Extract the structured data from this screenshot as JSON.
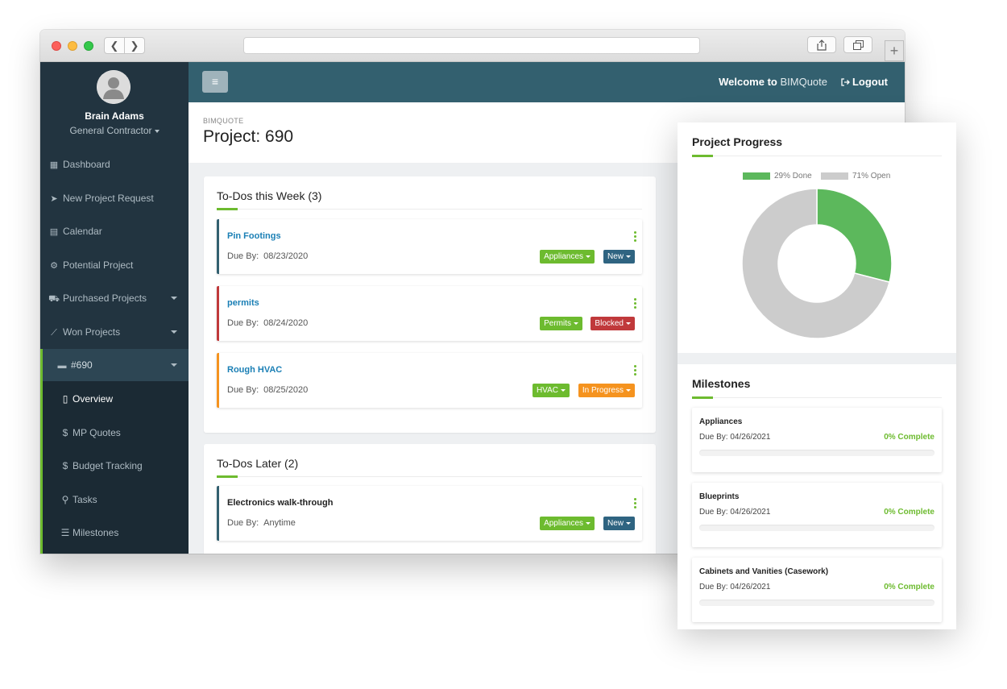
{
  "user": {
    "name": "Brain Adams",
    "role": "General Contractor"
  },
  "sidebar": {
    "items": [
      {
        "label": "Dashboard",
        "icon": "dashboard-icon",
        "has_children": false
      },
      {
        "label": "New Project Request",
        "icon": "paper-plane-icon",
        "has_children": false
      },
      {
        "label": "Calendar",
        "icon": "calendar-icon",
        "has_children": false
      },
      {
        "label": "Potential Project",
        "icon": "gears-icon",
        "has_children": false
      },
      {
        "label": "Purchased Projects",
        "icon": "cart-icon",
        "has_children": true
      },
      {
        "label": "Won Projects",
        "icon": "line-chart-icon",
        "has_children": true
      },
      {
        "label": "#690",
        "icon": "briefcase-icon",
        "has_children": true
      }
    ],
    "subitems": [
      {
        "label": "Overview",
        "icon": "rectangle-icon",
        "glyph": "▯"
      },
      {
        "label": "MP Quotes",
        "icon": "dollar-icon",
        "glyph": "$"
      },
      {
        "label": "Budget Tracking",
        "icon": "dollar-icon",
        "glyph": "$"
      },
      {
        "label": "Tasks",
        "icon": "pushpin-icon",
        "glyph": "⚲"
      },
      {
        "label": "Milestones",
        "icon": "sliders-icon",
        "glyph": "☰"
      }
    ]
  },
  "topbar": {
    "welcome": "Welcome to",
    "brand": "BIMQuote",
    "logout": "Logout"
  },
  "page": {
    "breadcrumb": "BIMQUOTE",
    "title": "Project: 690"
  },
  "todos_week": {
    "title": "To-Dos this Week (3)",
    "items": [
      {
        "title": "Pin Footings",
        "due_label": "Due By:",
        "due": "08/23/2020",
        "category": "Appliances",
        "status": "New"
      },
      {
        "title": "permits",
        "due_label": "Due By:",
        "due": "08/24/2020",
        "category": "Permits",
        "status": "Blocked"
      },
      {
        "title": "Rough HVAC",
        "due_label": "Due By:",
        "due": "08/25/2020",
        "category": "HVAC",
        "status": "In Progress"
      }
    ]
  },
  "todos_later": {
    "title": "To-Dos Later (2)",
    "items": [
      {
        "title": "Electronics walk-through",
        "due_label": "Due By:",
        "due": "Anytime",
        "category": "Appliances",
        "status": "New"
      }
    ]
  },
  "progress": {
    "title": "Project Progress",
    "colors": {
      "done": "#5cb85c",
      "open": "#cccccc"
    },
    "chart_data": {
      "type": "pie",
      "categories": [
        "Done",
        "Open"
      ],
      "values": [
        29,
        71
      ],
      "legend": [
        "29% Done",
        "71% Open"
      ],
      "legend_position": "top"
    }
  },
  "milestones": {
    "title": "Milestones",
    "items": [
      {
        "title": "Appliances",
        "due": "Due By: 04/26/2021",
        "percent_label": "0% Complete",
        "percent": 0
      },
      {
        "title": "Blueprints",
        "due": "Due By: 04/26/2021",
        "percent_label": "0% Complete",
        "percent": 0
      },
      {
        "title": "Cabinets and Vanities (Casework)",
        "due": "Due By: 04/26/2021",
        "percent_label": "0% Complete",
        "percent": 0
      }
    ]
  },
  "colors": {
    "sidebar": "#223440",
    "topbar": "#33606f",
    "accent": "#6dbb2f",
    "link": "#1a7fb5"
  }
}
